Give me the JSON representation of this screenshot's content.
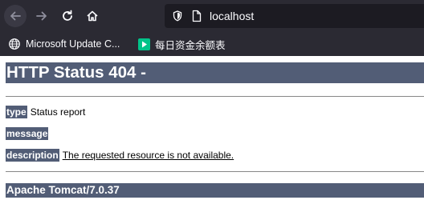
{
  "browser": {
    "url": "localhost",
    "bookmarks": [
      {
        "label": "Microsoft Update C...",
        "icon": "globe-icon"
      },
      {
        "label": "每日资金余额表",
        "icon": "play-store-icon"
      }
    ],
    "colors": {
      "chrome": "#2b2a33",
      "urlbar": "#1c1b22",
      "text": "#fbfbfe"
    }
  },
  "page": {
    "title": "HTTP Status 404 -",
    "rows": [
      {
        "label": "type",
        "value": "Status report"
      },
      {
        "label": "message",
        "value": ""
      },
      {
        "label": "description",
        "value": "The requested resource is not available."
      }
    ],
    "footer": "Apache Tomcat/7.0.37",
    "colors": {
      "bar": "#525d76",
      "bar_text": "#ffffff"
    }
  }
}
